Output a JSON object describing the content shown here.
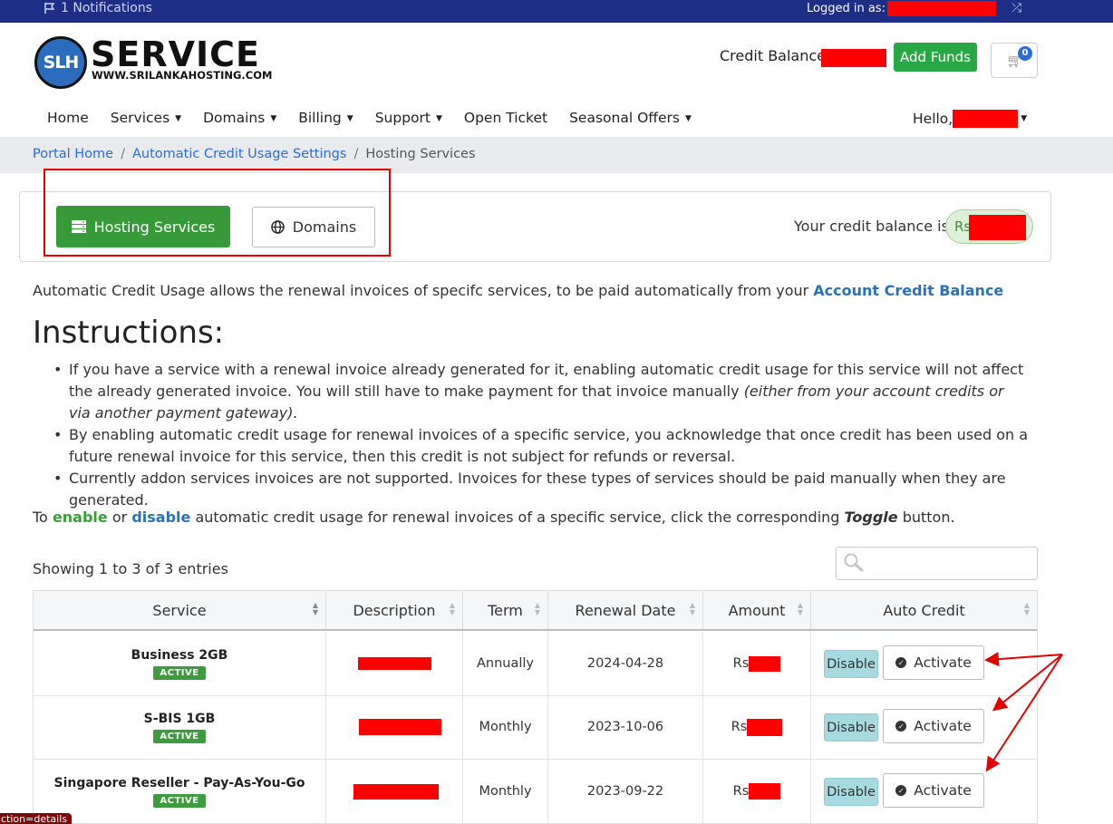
{
  "topbar": {
    "notifications": "1 Notifications",
    "logged_in": "Logged in as:"
  },
  "logo": {
    "mark": "SLH",
    "word": "SERVICE",
    "url": "WWW.SRILANKAHOSTING.COM"
  },
  "header": {
    "credit_label": "Credit Balance:",
    "add_funds": "Add Funds",
    "cart_count": "0"
  },
  "nav": {
    "items": [
      "Home",
      "Services",
      "Domains",
      "Billing",
      "Support",
      "Open Ticket",
      "Seasonal Offers"
    ],
    "hello": "Hello,"
  },
  "breadcrumb": {
    "home": "Portal Home",
    "parent": "Automatic Credit Usage Settings",
    "current": "Hosting Services"
  },
  "tabs": {
    "hosting": "Hosting Services",
    "domains": "Domains"
  },
  "credit_box": {
    "text": "Your credit balance is",
    "prefix": "Rs"
  },
  "intro": {
    "text": "Automatic Credit Usage allows the renewal invoices of specifc services, to be paid automatically from your ",
    "link": "Account Credit Balance"
  },
  "instructions": {
    "title": "Instructions:",
    "item1_a": "If you have a service with a renewal invoice already generated for it, enabling automatic credit usage for this service will not affect the already generated invoice. You will still have to make payment for that invoice manually ",
    "item1_b": "(either from your account credits or via another payment gateway).",
    "item2": "By enabling automatic credit usage for renewal invoices of a specific service, you acknowledge that once credit has been used on a future renewal invoice for this service, then this credit is not subject for refunds or reversal.",
    "item3": "Currently addon services invoices are not supported. Invoices for these types of services should be paid manually when they are generated."
  },
  "toggle_line": {
    "a": "To ",
    "enable": "enable",
    "b": " or ",
    "disable": "disable",
    "c": " automatic credit usage for renewal invoices of a specific service, click the corresponding ",
    "toggle": "Toggle",
    "d": " button."
  },
  "table": {
    "showing": "Showing 1 to 3 of 3 entries",
    "headers": [
      "Service",
      "Description",
      "Term",
      "Renewal Date",
      "Amount",
      "Auto Credit"
    ],
    "rows": [
      {
        "service": "Business 2GB",
        "status": "ACTIVE",
        "term": "Annually",
        "date": "2024-04-28",
        "amount": "Rs",
        "disable": "Disable",
        "activate": "Activate"
      },
      {
        "service": "S-BIS 1GB",
        "status": "ACTIVE",
        "term": "Monthly",
        "date": "2023-10-06",
        "amount": "Rs",
        "disable": "Disable",
        "activate": "Activate"
      },
      {
        "service": "Singapore Reseller - Pay-As-You-Go",
        "status": "ACTIVE",
        "term": "Monthly",
        "date": "2023-09-22",
        "amount": "Rs",
        "disable": "Disable",
        "activate": "Activate"
      }
    ]
  },
  "status_url": "ction=details",
  "colors": {
    "topbar": "#1e2d86",
    "accent_green": "#359a37",
    "link_blue": "#2a6dd8",
    "redaction": "#ff0000"
  }
}
